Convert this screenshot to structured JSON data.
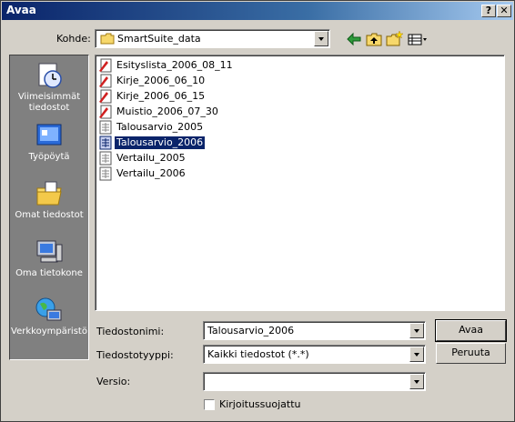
{
  "window": {
    "title": "Avaa",
    "help_label": "?",
    "close_label": "✕"
  },
  "lookin": {
    "label": "Kohde:",
    "value": "SmartSuite_data"
  },
  "places": [
    {
      "label": "Viimeisimmät tiedostot",
      "icon": "recent-documents-icon"
    },
    {
      "label": "Työpöytä",
      "icon": "desktop-icon"
    },
    {
      "label": "Omat tiedostot",
      "icon": "my-documents-icon"
    },
    {
      "label": "Oma tietokone",
      "icon": "my-computer-icon"
    },
    {
      "label": "Verkkoympäristö",
      "icon": "network-places-icon"
    }
  ],
  "files": [
    {
      "name": "Esityslista_2006_08_11",
      "type": "document",
      "selected": false
    },
    {
      "name": "Kirje_2006_06_10",
      "type": "document",
      "selected": false
    },
    {
      "name": "Kirje_2006_06_15",
      "type": "document",
      "selected": false
    },
    {
      "name": "Muistio_2006_07_30",
      "type": "document",
      "selected": false
    },
    {
      "name": "Talousarvio_2005",
      "type": "spreadsheet",
      "selected": false
    },
    {
      "name": "Talousarvio_2006",
      "type": "spreadsheet",
      "selected": true
    },
    {
      "name": "Vertailu_2005",
      "type": "spreadsheet",
      "selected": false
    },
    {
      "name": "Vertailu_2006",
      "type": "spreadsheet",
      "selected": false
    }
  ],
  "filename": {
    "label": "Tiedostonimi:",
    "value": "Talousarvio_2006"
  },
  "filetype": {
    "label": "Tiedostotyyppi:",
    "value": "Kaikki tiedostot (*.*)"
  },
  "version": {
    "label": "Versio:",
    "value": ""
  },
  "readonly": {
    "label": "Kirjoitussuojattu",
    "checked": false
  },
  "buttons": {
    "open": "Avaa",
    "cancel": "Peruuta"
  }
}
